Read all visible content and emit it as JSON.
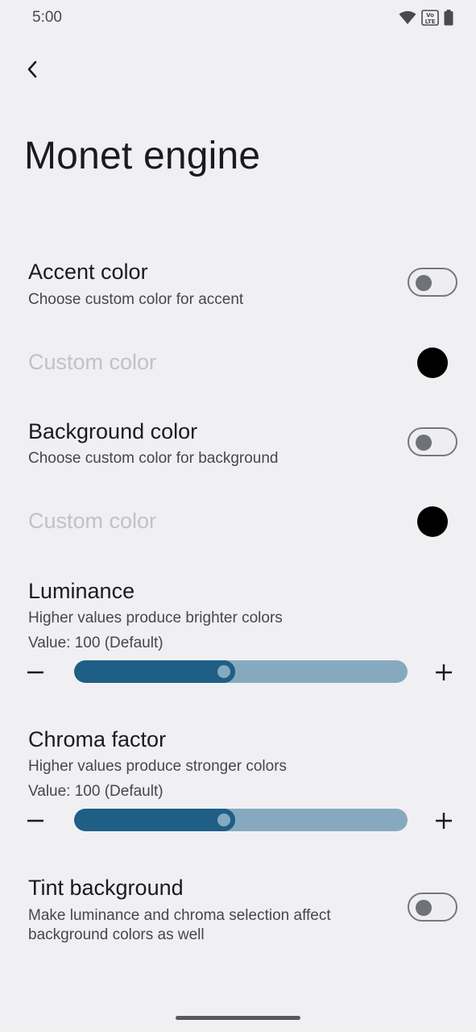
{
  "status_bar": {
    "time": "5:00",
    "volte_label": "Vo LTE"
  },
  "header": {
    "title": "Monet engine"
  },
  "accent_color": {
    "title": "Accent color",
    "subtitle": "Choose custom color for accent",
    "enabled": false
  },
  "accent_custom_color": {
    "label": "Custom color",
    "color": "#000000",
    "disabled": true
  },
  "background_color": {
    "title": "Background color",
    "subtitle": "Choose custom color for background",
    "enabled": false
  },
  "background_custom_color": {
    "label": "Custom color",
    "color": "#000000",
    "disabled": true
  },
  "luminance": {
    "title": "Luminance",
    "subtitle": "Higher values produce brighter colors",
    "value_text": "Value: 100 (Default)",
    "slider_fraction": 0.45
  },
  "chroma": {
    "title": "Chroma factor",
    "subtitle": "Higher values produce stronger colors",
    "value_text": "Value: 100 (Default)",
    "slider_fraction": 0.45
  },
  "tint_background": {
    "title": "Tint background",
    "subtitle_line1": "Make luminance and chroma selection affect",
    "subtitle_line2": "background colors as well",
    "enabled": false
  },
  "colors": {
    "background": "#f0f0f3",
    "slider_active": "#1f5f85",
    "slider_inactive": "#87a9bf",
    "disabled_text": "#c2c2c6"
  }
}
